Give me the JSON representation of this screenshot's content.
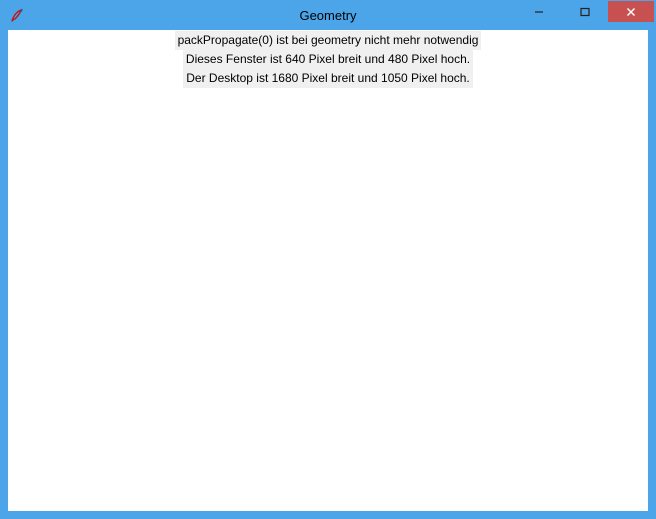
{
  "window": {
    "title": "Geometry",
    "icon_name": "tk-feather-icon"
  },
  "titlebar_buttons": {
    "minimize": "minimize",
    "maximize": "maximize",
    "close": "close"
  },
  "labels": [
    "packPropagate(0) ist bei geometry nicht mehr notwendig",
    "Dieses Fenster ist 640 Pixel breit und 480 Pixel hoch.",
    "Der Desktop ist 1680 Pixel breit und 1050 Pixel hoch."
  ],
  "colors": {
    "titlebar": "#4ba5e8",
    "close_button": "#c75050",
    "label_bg": "#f0f0f0"
  }
}
